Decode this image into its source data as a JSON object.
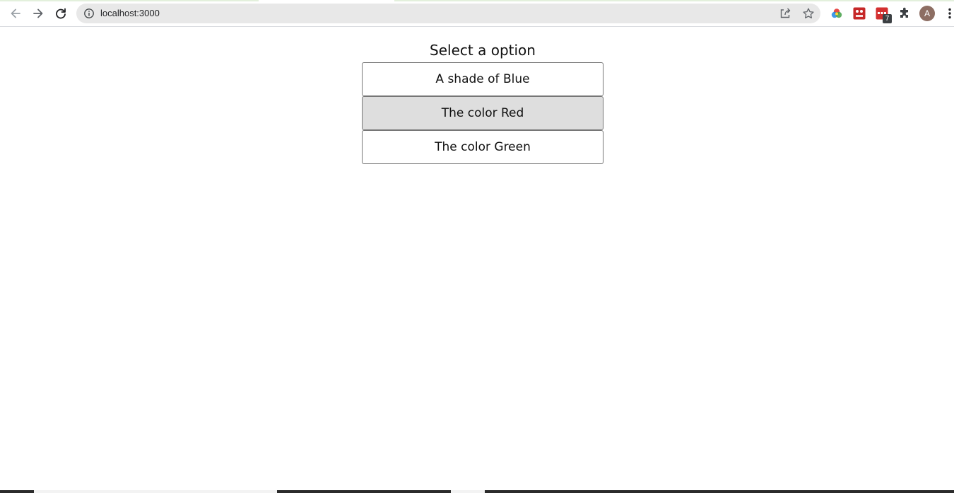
{
  "browser": {
    "url": "localhost:3000",
    "nav": {
      "back_icon": "arrow-left-icon",
      "forward_icon": "arrow-right-icon",
      "reload_icon": "reload-icon"
    },
    "omnibox": {
      "info_icon": "info-icon",
      "share_icon": "share-icon",
      "bookmark_icon": "star-icon"
    },
    "extensions": {
      "badge_count": "7",
      "icons": [
        "color-wheel-icon",
        "red-extension-icon",
        "red-badge-extension-icon",
        "puzzle-icon"
      ]
    },
    "profile_initial": "A",
    "menu_icon": "kebab-menu-icon"
  },
  "page": {
    "prompt": "Select a option",
    "options": [
      {
        "label": "A shade of Blue",
        "state": "default"
      },
      {
        "label": "The color Red",
        "state": "hover"
      },
      {
        "label": "The color Green",
        "state": "default"
      }
    ]
  },
  "colors": {
    "option_hover_bg": "#dedede",
    "option_border": "#767676",
    "omnibox_bg": "#e8e8e8",
    "avatar_bg": "#8d6e63"
  }
}
